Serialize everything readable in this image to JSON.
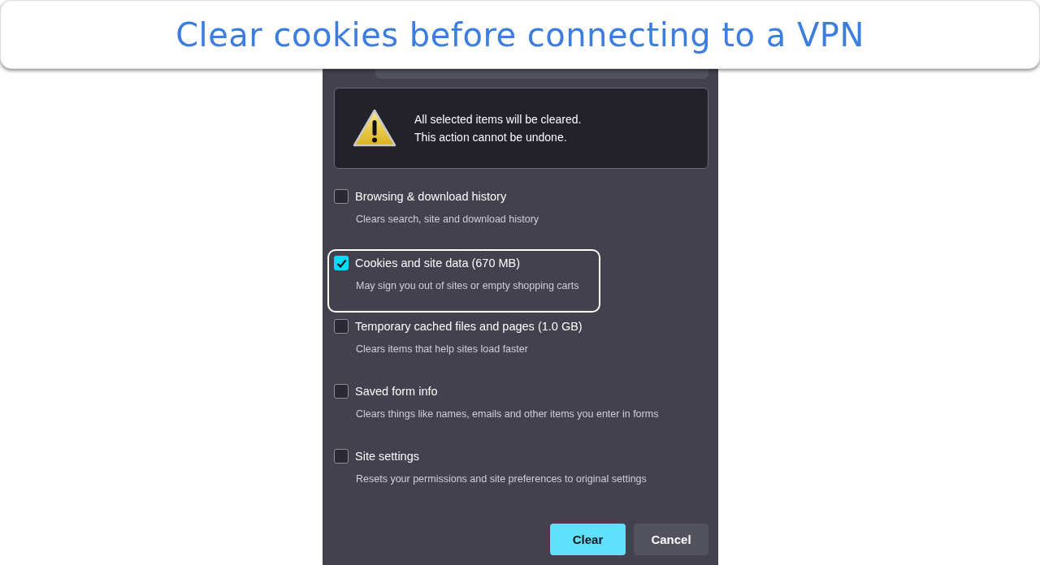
{
  "banner": {
    "title": "Clear cookies before connecting to a VPN"
  },
  "warning": {
    "lines": [
      "All selected items will be cleared.",
      "This action cannot be undone."
    ]
  },
  "options": [
    {
      "label": "Browsing & download history",
      "description": "Clears search, site and download history",
      "checked": false,
      "highlighted": false
    },
    {
      "label": "Cookies and site data (670 MB)",
      "description": "May sign you out of sites or empty shopping carts",
      "checked": true,
      "highlighted": true
    },
    {
      "label": "Temporary cached files and pages (1.0 GB)",
      "description": "Clears items that help sites load faster",
      "checked": false,
      "highlighted": false
    },
    {
      "label": "Saved form info",
      "description": "Clears things like names, emails and other items you enter in forms",
      "checked": false,
      "highlighted": false
    },
    {
      "label": "Site settings",
      "description": "Resets your permissions and site preferences to original settings",
      "checked": false,
      "highlighted": false
    }
  ],
  "buttons": [
    {
      "label": "Clear",
      "kind": "primary"
    },
    {
      "label": "Cancel",
      "kind": "secondary"
    }
  ]
}
